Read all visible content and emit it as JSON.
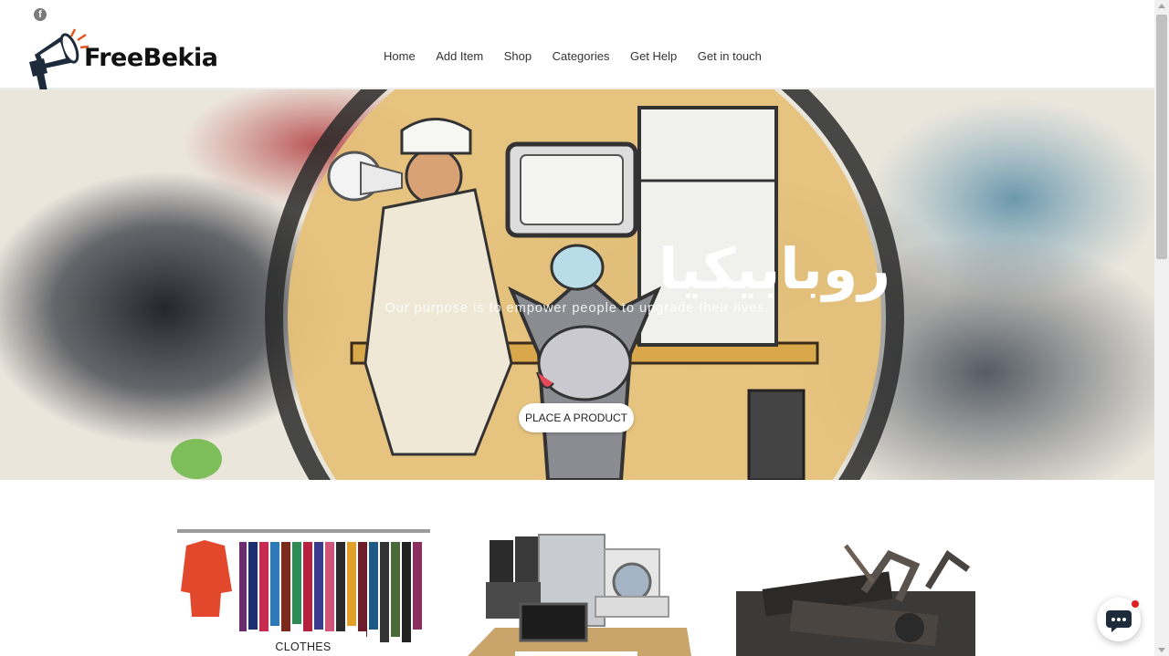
{
  "header": {
    "social_icon": "facebook-icon",
    "logo_text": "FreeBekia",
    "nav": [
      "Home",
      "Add Item",
      "Shop",
      "Categories",
      "Get Help",
      "Get in touch"
    ]
  },
  "hero": {
    "arabic_title": "روبابيكيا",
    "tagline": "Our purpose is to empower people to upgrade their lives.",
    "cta": "PLACE A PRODUCT"
  },
  "categories": [
    {
      "label": "CLOTHES"
    },
    {
      "label": ""
    },
    {
      "label": ""
    }
  ],
  "chat": {
    "icon": "chat-bubble-icon",
    "badge_color": "#e02020"
  },
  "colors": {
    "accent": "#e8541e",
    "logo_dark": "#1e2b3a"
  }
}
